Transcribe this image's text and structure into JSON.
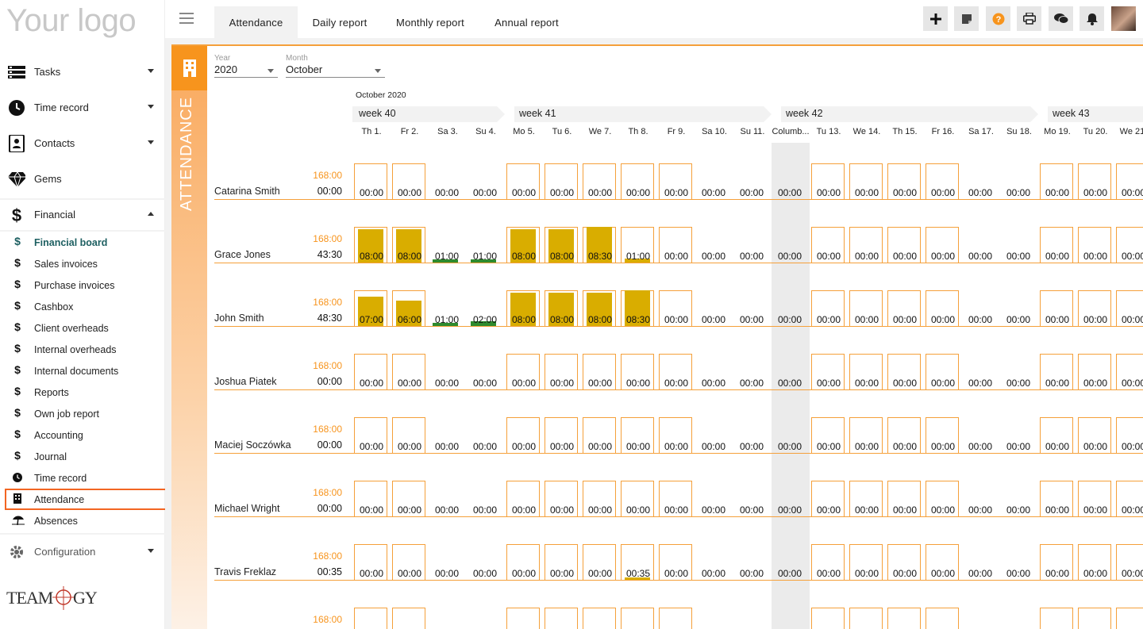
{
  "logo": "Your logo",
  "nav": [
    {
      "label": "Tasks",
      "icon": "tasks-icon"
    },
    {
      "label": "Time record",
      "icon": "clock-icon"
    },
    {
      "label": "Contacts",
      "icon": "contacts-icon"
    },
    {
      "label": "Gems",
      "icon": "gem-icon"
    },
    {
      "label": "Financial",
      "icon": "dollar-icon"
    }
  ],
  "financial_items": [
    {
      "label": "Financial board",
      "icon": "dollar-icon",
      "active": true
    },
    {
      "label": "Sales invoices",
      "icon": "dollar-icon"
    },
    {
      "label": "Purchase invoices",
      "icon": "dollar-icon"
    },
    {
      "label": "Cashbox",
      "icon": "dollar-icon"
    },
    {
      "label": "Client overheads",
      "icon": "dollar-icon"
    },
    {
      "label": "Internal overheads",
      "icon": "dollar-icon"
    },
    {
      "label": "Internal documents",
      "icon": "dollar-icon"
    },
    {
      "label": "Reports",
      "icon": "dollar-icon"
    },
    {
      "label": "Own job report",
      "icon": "dollar-icon"
    },
    {
      "label": "Accounting",
      "icon": "dollar-icon"
    },
    {
      "label": "Journal",
      "icon": "dollar-icon"
    },
    {
      "label": "Time record",
      "icon": "clock-icon"
    },
    {
      "label": "Attendance",
      "icon": "building-icon",
      "highlighted": true
    },
    {
      "label": "Absences",
      "icon": "beach-icon"
    }
  ],
  "configuration": "Configuration",
  "brand": "TEAMOGY",
  "tabs": [
    "Attendance",
    "Daily report",
    "Monthly report",
    "Annual report"
  ],
  "toolbar": [
    "add-icon",
    "note-icon",
    "help-icon",
    "print-icon",
    "chat-icon",
    "bell-icon"
  ],
  "strip_title": "ATTENDANCE",
  "filters": {
    "year_label": "Year",
    "year": "2020",
    "month_label": "Month",
    "month": "October"
  },
  "month_title": "October 2020",
  "weeks": [
    "week 40",
    "week 41",
    "week 42",
    "week 43"
  ],
  "days": [
    "Th 1.",
    "Fr 2.",
    "Sa 3.",
    "Su 4.",
    "Mo 5.",
    "Tu 6.",
    "We 7.",
    "Th 8.",
    "Fr 9.",
    "Sa 10.",
    "Su 11.",
    "Columb...",
    "Tu 13.",
    "We 14.",
    "Th 15.",
    "Fr 16.",
    "Sa 17.",
    "Su 18.",
    "Mo 19.",
    "Tu 20.",
    "We 21."
  ],
  "target": "168:00",
  "people": [
    {
      "name": "Catarina Smith",
      "total": "00:00",
      "hours": [
        0,
        0,
        0,
        0,
        0,
        0,
        0,
        0,
        0,
        0,
        0,
        0,
        0,
        0,
        0,
        0,
        0,
        0,
        0,
        0,
        0
      ],
      "labels": [
        "00:00",
        "00:00",
        "00:00",
        "00:00",
        "00:00",
        "00:00",
        "00:00",
        "00:00",
        "00:00",
        "00:00",
        "00:00",
        "00:00",
        "00:00",
        "00:00",
        "00:00",
        "00:00",
        "00:00",
        "00:00",
        "00:00",
        "00:00",
        "00:00"
      ]
    },
    {
      "name": "Grace Jones",
      "total": "43:30",
      "hours": [
        8,
        8,
        1,
        1,
        8,
        8,
        8.5,
        1,
        0,
        0,
        0,
        0,
        0,
        0,
        0,
        0,
        0,
        0,
        0,
        0,
        0
      ],
      "labels": [
        "08:00",
        "08:00",
        "01:00",
        "01:00",
        "08:00",
        "08:00",
        "08:30",
        "01:00",
        "00:00",
        "00:00",
        "00:00",
        "00:00",
        "00:00",
        "00:00",
        "00:00",
        "00:00",
        "00:00",
        "00:00",
        "00:00",
        "00:00",
        "00:00"
      ]
    },
    {
      "name": "John Smith",
      "total": "48:30",
      "hours": [
        7,
        6,
        1,
        2,
        8,
        8,
        8,
        8.5,
        0,
        0,
        0,
        0,
        0,
        0,
        0,
        0,
        0,
        0,
        0,
        0,
        0
      ],
      "labels": [
        "07:00",
        "06:00",
        "01:00",
        "02:00",
        "08:00",
        "08:00",
        "08:00",
        "08:30",
        "00:00",
        "00:00",
        "00:00",
        "00:00",
        "00:00",
        "00:00",
        "00:00",
        "00:00",
        "00:00",
        "00:00",
        "00:00",
        "00:00",
        "00:00"
      ]
    },
    {
      "name": "Joshua Piatek",
      "total": "00:00",
      "hours": [
        0,
        0,
        0,
        0,
        0,
        0,
        0,
        0,
        0,
        0,
        0,
        0,
        0,
        0,
        0,
        0,
        0,
        0,
        0,
        0,
        0
      ],
      "labels": [
        "00:00",
        "00:00",
        "00:00",
        "00:00",
        "00:00",
        "00:00",
        "00:00",
        "00:00",
        "00:00",
        "00:00",
        "00:00",
        "00:00",
        "00:00",
        "00:00",
        "00:00",
        "00:00",
        "00:00",
        "00:00",
        "00:00",
        "00:00",
        "00:00"
      ]
    },
    {
      "name": "Maciej Soczówka",
      "total": "00:00",
      "hours": [
        0,
        0,
        0,
        0,
        0,
        0,
        0,
        0,
        0,
        0,
        0,
        0,
        0,
        0,
        0,
        0,
        0,
        0,
        0,
        0,
        0
      ],
      "labels": [
        "00:00",
        "00:00",
        "00:00",
        "00:00",
        "00:00",
        "00:00",
        "00:00",
        "00:00",
        "00:00",
        "00:00",
        "00:00",
        "00:00",
        "00:00",
        "00:00",
        "00:00",
        "00:00",
        "00:00",
        "00:00",
        "00:00",
        "00:00",
        "00:00"
      ]
    },
    {
      "name": "Michael Wright",
      "total": "00:00",
      "hours": [
        0,
        0,
        0,
        0,
        0,
        0,
        0,
        0,
        0,
        0,
        0,
        0,
        0,
        0,
        0,
        0,
        0,
        0,
        0,
        0,
        0
      ],
      "labels": [
        "00:00",
        "00:00",
        "00:00",
        "00:00",
        "00:00",
        "00:00",
        "00:00",
        "00:00",
        "00:00",
        "00:00",
        "00:00",
        "00:00",
        "00:00",
        "00:00",
        "00:00",
        "00:00",
        "00:00",
        "00:00",
        "00:00",
        "00:00",
        "00:00"
      ]
    },
    {
      "name": "Travis Freklaz",
      "total": "00:35",
      "hours": [
        0,
        0,
        0,
        0,
        0,
        0,
        0,
        0.58,
        0,
        0,
        0,
        0,
        0,
        0,
        0,
        0,
        0,
        0,
        0,
        0,
        0
      ],
      "labels": [
        "00:00",
        "00:00",
        "00:00",
        "00:00",
        "00:00",
        "00:00",
        "00:00",
        "00:35",
        "00:00",
        "00:00",
        "00:00",
        "00:00",
        "00:00",
        "00:00",
        "00:00",
        "00:00",
        "00:00",
        "00:00",
        "00:00",
        "00:00",
        "00:00"
      ]
    },
    {
      "name": "",
      "total": "",
      "hours": [
        0,
        0,
        0,
        0,
        0,
        0,
        0,
        0,
        0,
        0,
        0,
        0,
        0,
        0,
        0,
        0,
        0,
        0,
        0,
        0,
        0
      ],
      "labels": []
    }
  ],
  "weekend_days": [
    2,
    3,
    9,
    10,
    16,
    17
  ],
  "holiday_days": [
    11
  ],
  "colors": {
    "accent": "#f7941d",
    "bar": "#d9ad00",
    "weekend_bar": "#2e8b2e",
    "active_nav": "#1d5f61",
    "highlight": "#f26522"
  }
}
